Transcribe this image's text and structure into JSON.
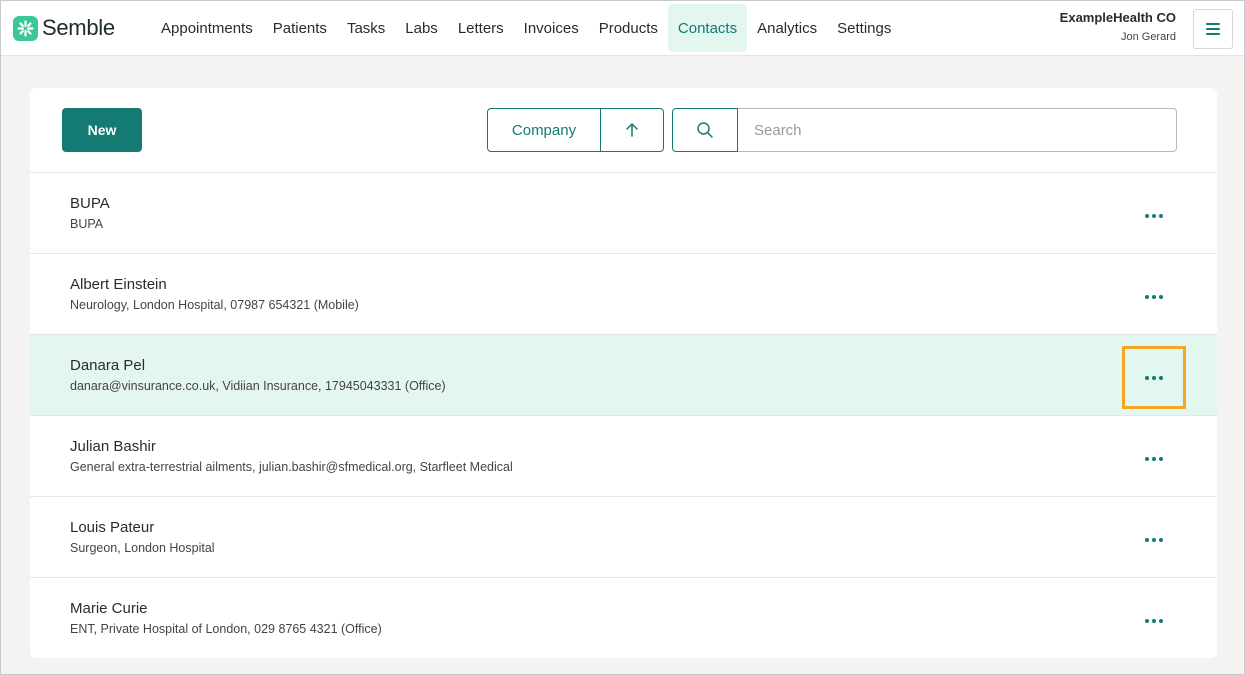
{
  "brand": {
    "name": "Semble"
  },
  "nav": {
    "items": [
      {
        "label": "Appointments"
      },
      {
        "label": "Patients"
      },
      {
        "label": "Tasks"
      },
      {
        "label": "Labs"
      },
      {
        "label": "Letters"
      },
      {
        "label": "Invoices"
      },
      {
        "label": "Products"
      },
      {
        "label": "Contacts",
        "active": true
      },
      {
        "label": "Analytics"
      },
      {
        "label": "Settings"
      }
    ]
  },
  "account": {
    "org": "ExampleHealth CO",
    "user": "Jon Gerard"
  },
  "toolbar": {
    "new_label": "New",
    "sort_field": "Company",
    "sort_direction_icon": "arrow-up-icon",
    "search_placeholder": "Search"
  },
  "contacts": [
    {
      "name": "BUPA",
      "detail": "BUPA"
    },
    {
      "name": "Albert Einstein",
      "detail": "Neurology, London Hospital, 07987 654321 (Mobile)"
    },
    {
      "name": "Danara Pel",
      "detail": "danara@vinsurance.co.uk, Vidiian Insurance, 17945043331 (Office)",
      "highlighted": true
    },
    {
      "name": "Julian Bashir",
      "detail": "General extra-terrestrial ailments, julian.bashir@sfmedical.org, Starfleet Medical"
    },
    {
      "name": "Louis Pateur",
      "detail": "Surgeon, London Hospital"
    },
    {
      "name": "Marie Curie",
      "detail": "ENT, Private Hospital of London, 029 8765 4321 (Office)"
    }
  ],
  "colors": {
    "accent": "#137a74",
    "highlight_row": "#e3f6f0",
    "focus_outline": "#f5a623",
    "logo": "#3cc79b"
  }
}
